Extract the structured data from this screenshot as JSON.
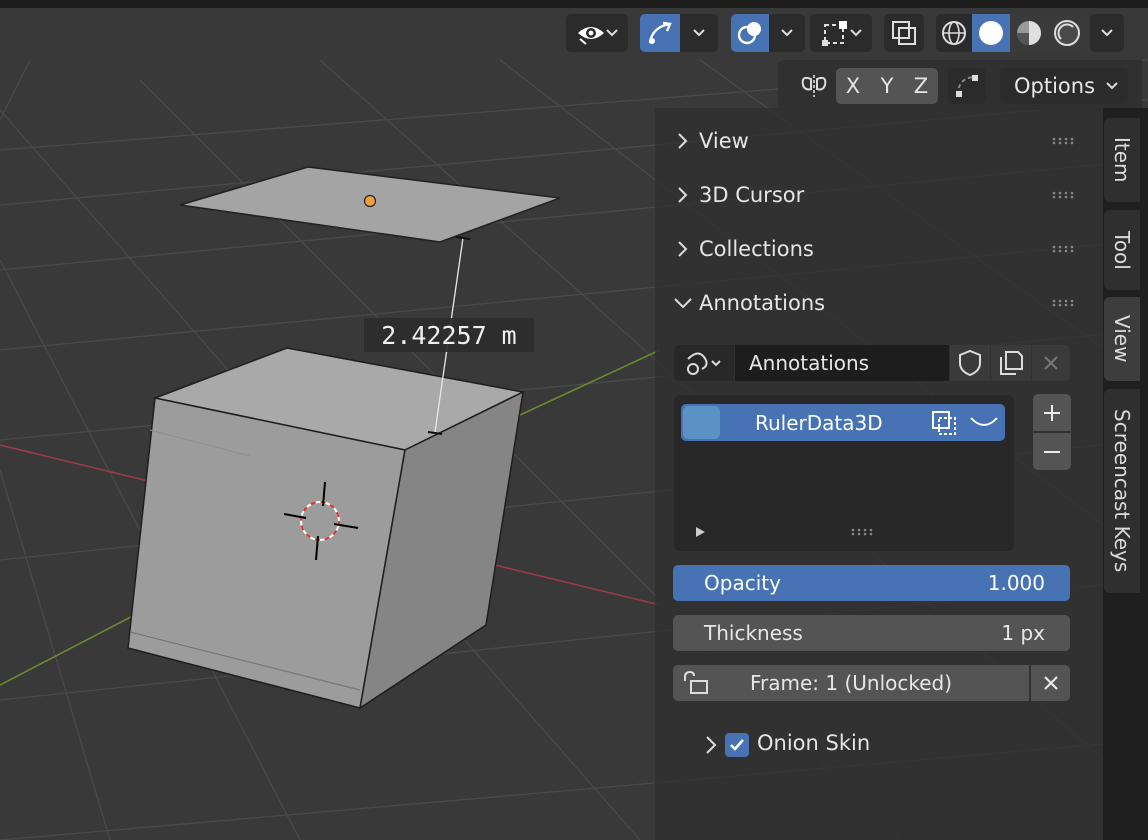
{
  "viewport": {
    "measurement_label": "2.42257 m"
  },
  "header": {
    "axis_buttons": [
      "X",
      "Y",
      "Z"
    ],
    "options_label": "Options"
  },
  "sidebar": {
    "panels": [
      {
        "label": "View",
        "expanded": false
      },
      {
        "label": "3D Cursor",
        "expanded": false
      },
      {
        "label": "Collections",
        "expanded": false
      },
      {
        "label": "Annotations",
        "expanded": true
      }
    ],
    "annotations": {
      "datablock_name": "Annotations",
      "layers": [
        {
          "name": "RulerData3D",
          "color": "#5b92c5"
        }
      ],
      "opacity_label": "Opacity",
      "opacity_value": "1.000",
      "thickness_label": "Thickness",
      "thickness_value": "1 px",
      "frame_label": "Frame: 1 (Unlocked)",
      "onion_skin_label": "Onion Skin",
      "onion_skin_checked": true
    },
    "tabs": [
      "Item",
      "Tool",
      "View",
      "Screencast Keys"
    ],
    "active_tab": "View"
  },
  "colors": {
    "accent": "#4772b3",
    "background": "#393939",
    "panel": "#303030"
  }
}
